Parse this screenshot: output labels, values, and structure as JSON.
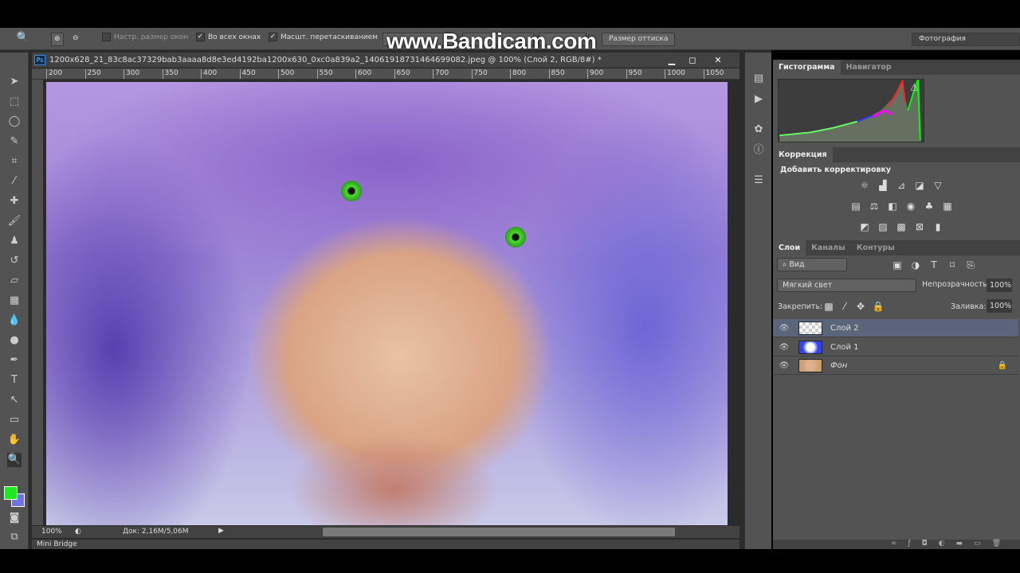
{
  "options_bar": {
    "checkbox_fit_windows": "Настр. размер окон",
    "checkbox_all_windows": "Во всех окнах",
    "checkbox_scrubby_zoom": "Масшт. перетаскиванием",
    "button_print_size": "Размер оттиска",
    "workspace": "Фотография"
  },
  "watermark": "www.Bandicam.com",
  "document": {
    "title": "1200x628_21_83c8ac37329bab3aaaa8d8e3ed4192ba1200x630_0xc0a839a2_14061918731464699082.jpeg @ 100% (Слой 2, RGB/8#) *",
    "ruler_ticks": [
      "200",
      "250",
      "300",
      "350",
      "400",
      "450",
      "500",
      "550",
      "600",
      "650",
      "700",
      "750",
      "800",
      "850",
      "900",
      "950",
      "1000",
      "1050"
    ],
    "zoom": "100%",
    "doc_size": "Док: 2,16M/5,06M"
  },
  "mini_bridge": "Mini Bridge",
  "colors": {
    "foreground": "#1ee81e",
    "background": "#6f74e8"
  },
  "histogram_panel": {
    "tabs": [
      "Гистограмма",
      "Навигатор"
    ]
  },
  "adjustments_panel": {
    "tab": "Коррекция",
    "heading": "Добавить корректировку"
  },
  "layers_panel": {
    "tabs": [
      "Слои",
      "Каналы",
      "Контуры"
    ],
    "filter": "Вид",
    "blend_mode": "Мягкий свет",
    "opacity_label": "Непрозрачность:",
    "opacity": "100%",
    "lock_label": "Закрепить:",
    "fill_label": "Заливка:",
    "fill": "100%",
    "layers": [
      {
        "name": "Слой 2",
        "selected": true
      },
      {
        "name": "Слой 1",
        "selected": false
      },
      {
        "name": "Фон",
        "selected": false,
        "locked": true
      }
    ]
  }
}
